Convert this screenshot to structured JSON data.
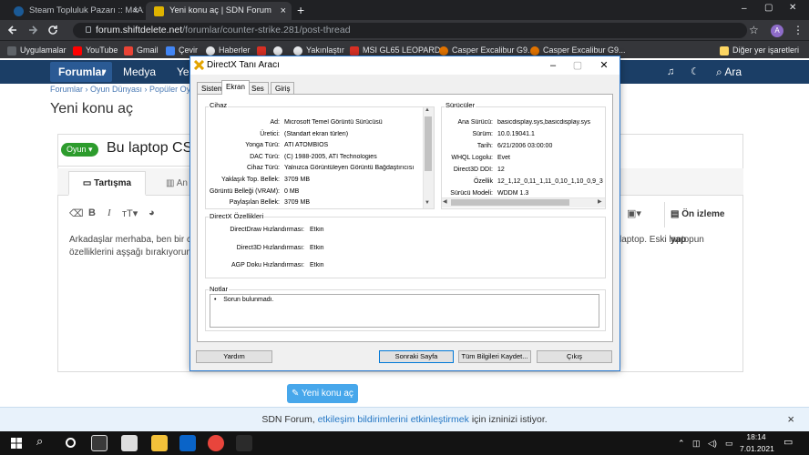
{
  "browser": {
    "tabs": [
      {
        "title": "Steam Topluluk Pazarı :: M4A1-S",
        "close": "×"
      },
      {
        "title": "Yeni konu aç | SDN Forum",
        "close": "×"
      }
    ],
    "new_tab": "+",
    "url_domain": "forum.shiftdelete.net",
    "url_path": "/forumlar/counter-strike.281/post-thread",
    "profile": "A",
    "bookmarks": [
      "Uygulamalar",
      "YouTube",
      "Gmail",
      "Çevir",
      "Haberler",
      "Yakınlaştır",
      "MSI GL65 LEOPARD...",
      "Casper Excalibur G9...",
      "Casper Excalibur G9..."
    ],
    "other_bookmarks": "Diğer yer işaretleri",
    "window_controls": [
      "–",
      "▢",
      "✕"
    ]
  },
  "site": {
    "nav": [
      "Forumlar",
      "Medya",
      "Ye"
    ],
    "search": "Ara",
    "breadcrumbs": [
      "Forumlar",
      "Oyun Dünyası",
      "Popüler Oy"
    ],
    "page_title": "Yeni konu aç",
    "prefix": "Oyun",
    "thread_title": "Bu laptop CS",
    "editor_tabs": [
      "Tartışma",
      "An"
    ],
    "preview": "Ön izleme yap",
    "body_line1": "Arkadaşlar merhaba, ben bir cs",
    "body_line1_end": "laptop. Eski laptopun",
    "body_line2": "özelliklerini aşşağı bırakıyorum",
    "submit": "Yeni konu aç",
    "notif_pre": "SDN Forum,",
    "notif_link": "etkileşim bildirimlerini etkinleştirmek",
    "notif_post": "için izninizi istiyor.",
    "notif_close": "×"
  },
  "dialog": {
    "title": "DirectX Tanı Aracı",
    "tabs": [
      "Sistem",
      "Ekran",
      "Ses",
      "Giriş"
    ],
    "selected_tab": "Ekran",
    "device_group": "Cihaz",
    "device_rows": [
      {
        "label": "Ad:",
        "value": "Microsoft Temel Görüntü Sürücüsü"
      },
      {
        "label": "Üretici:",
        "value": "(Standart ekran türleri)"
      },
      {
        "label": "Yonga Türü:",
        "value": "ATI ATOMBIOS"
      },
      {
        "label": "DAC Türü:",
        "value": "(C) 1988-2005, ATI Technologies"
      },
      {
        "label": "Cihaz Türü:",
        "value": "Yalnızca Görüntüleyen Görüntü Bağdaştırıcısı"
      },
      {
        "label": "Yaklaşık Top. Bellek:",
        "value": "3709 MB"
      },
      {
        "label": "Görüntü Belleği (VRAM):",
        "value": "0 MB"
      },
      {
        "label": "Paylaşılan Bellek:",
        "value": "3709 MB"
      }
    ],
    "drivers_group": "Sürücüler",
    "driver_rows": [
      {
        "label": "Ana Sürücü:",
        "value": "basicdisplay.sys,basicdisplay.sys"
      },
      {
        "label": "Sürüm:",
        "value": "10.0.19041.1"
      },
      {
        "label": "Tarih:",
        "value": "6/21/2006 03:00:00"
      },
      {
        "label": "WHQL Logolu:",
        "value": "Evet"
      },
      {
        "label": "Direct3D DDI:",
        "value": "12"
      },
      {
        "label": "Özellik",
        "value": "12_1,12_0,11_1,11_0,10_1,10_0,9_3"
      },
      {
        "label": "Sürücü Modeli:",
        "value": "WDDM 1.3"
      }
    ],
    "dx_group": "DirectX Özellikleri",
    "dx_rows": [
      {
        "label": "DirectDraw Hızlandırması:",
        "value": "Etkin"
      },
      {
        "label": "Direct3D Hızlandırması:",
        "value": "Etkin"
      },
      {
        "label": "AGP Doku Hızlandırması:",
        "value": "Etkin"
      }
    ],
    "notes_group": "Notlar",
    "note": "Sorun bulunmadı.",
    "buttons": {
      "help": "Yardım",
      "next": "Sonraki Sayfa",
      "save": "Tüm Bilgileri Kaydet...",
      "exit": "Çıkış"
    },
    "scroll_up": "▲",
    "scroll_down": "▼",
    "scroll_left": "◀",
    "scroll_right": "▶"
  },
  "taskbar": {
    "time": "18:14",
    "date": "7.01.2021"
  },
  "colors": {
    "site_nav": "#1b3e66",
    "accent": "#47a7eb",
    "dialog_border": "#2b79d0"
  }
}
